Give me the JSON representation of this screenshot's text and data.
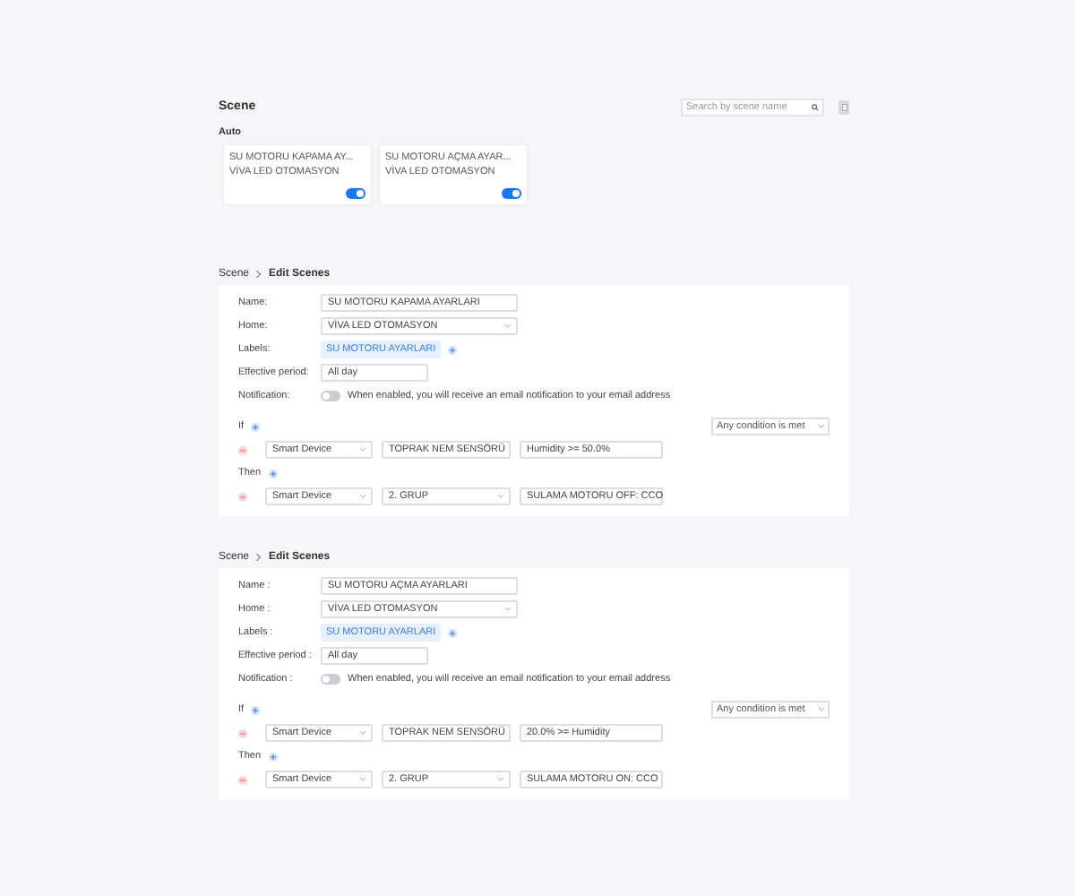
{
  "header": {
    "title": "Scene",
    "search": {
      "placeholder": "Search by scene name"
    }
  },
  "auto": {
    "title": "Auto",
    "cards": [
      {
        "name": "SU MOTORU KAPAMA AY...",
        "home": "VİVA LED OTOMASYON",
        "on": true
      },
      {
        "name": "SU MOTORU AÇMA AYAR...",
        "home": "VİVA LED OTOMASYON",
        "on": true
      }
    ]
  },
  "editors": [
    {
      "breadcrumb": [
        "Scene",
        "Edit Scenes"
      ],
      "name_label": "Name:",
      "name": "SU MOTORU KAPAMA AYARLARI",
      "home_label": "Home:",
      "home": "VİVA LED OTOMASYON",
      "labels_label": "Labels:",
      "labels": [
        "SU MOTORU AYARLARI"
      ],
      "period_label": "Effective period:",
      "period": "All day",
      "notification_label": "Notification:",
      "notification_on": false,
      "notification_text": "When enabled, you will receive an email notification to your email address",
      "if_label": "If",
      "match": "Any condition is met",
      "conditions": [
        [
          "Smart Device",
          "TOPRAK NEM SENSÖRÜ",
          "Humidity >= 50.0%"
        ]
      ],
      "then_label": "Then",
      "actions": [
        [
          "Smart Device",
          "2. GRUP",
          "SULAMA MOTORU OFF: CCO"
        ]
      ]
    },
    {
      "breadcrumb": [
        "Scene",
        "Edit Scenes"
      ],
      "name_label": "Name :",
      "name": "SU MOTORU AÇMA AYARLARI",
      "home_label": "Home :",
      "home": "VİVA LED OTOMASYON",
      "labels_label": "Labels :",
      "labels": [
        "SU MOTORU AYARLARI"
      ],
      "period_label": "Effective period :",
      "period": "All day",
      "notification_label": "Notification :",
      "notification_on": false,
      "notification_text": "When enabled, you will receive an email notification to your email address",
      "if_label": "If",
      "match": "Any condition is met",
      "conditions": [
        [
          "Smart Device",
          "TOPRAK NEM SENSÖRÜ",
          "20.0% >= Humidity"
        ]
      ],
      "then_label": "Then",
      "actions": [
        [
          "Smart Device",
          "2. GRUP",
          "SULAMA MOTORU ON: CCO"
        ]
      ]
    }
  ]
}
